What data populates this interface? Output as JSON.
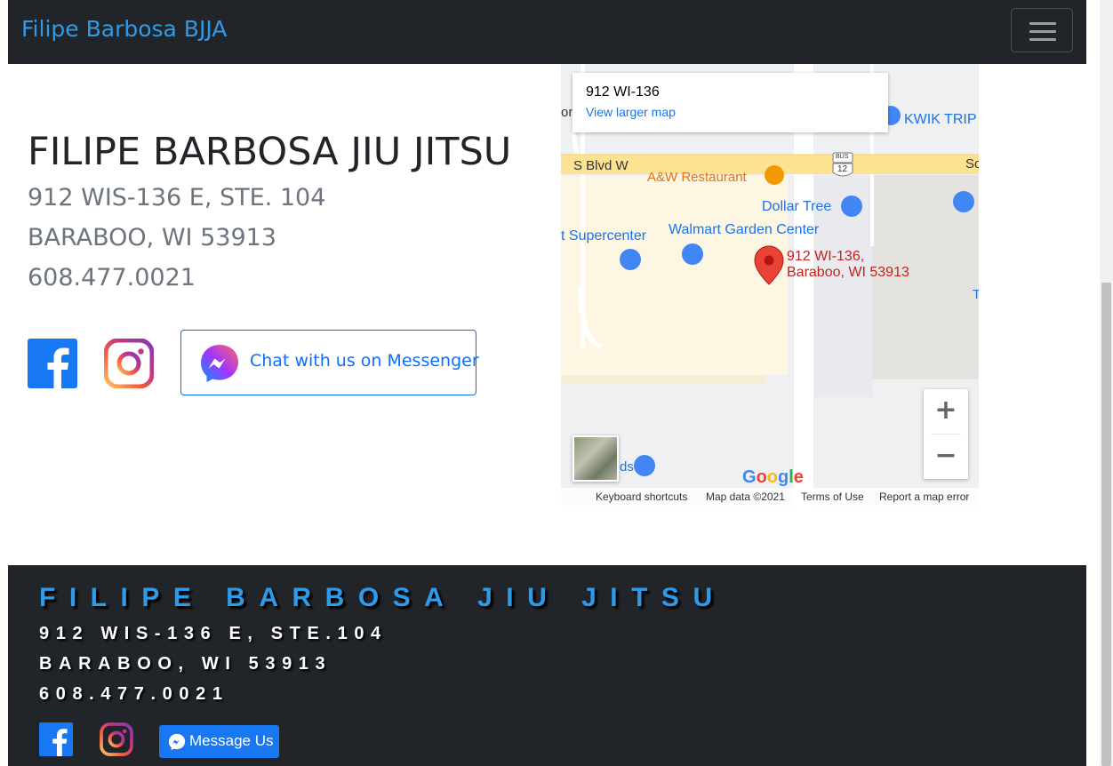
{
  "navbar": {
    "brand": "Filipe Barbosa BJJA",
    "toggle_icon": "hamburger-menu-icon"
  },
  "contact": {
    "title": "FILIPE BARBOSA JIU JITSU",
    "address_line1": "912 WIS-136 E, STE. 104",
    "address_line2": "BARABOO, WI 53913",
    "phone": "608.477.0021",
    "messenger_button": "Chat with us on Messenger",
    "icons": [
      "facebook-icon",
      "instagram-icon",
      "messenger-icon"
    ]
  },
  "map": {
    "card_address": "912 WI-136",
    "card_link": "View larger map",
    "pin_line1": "912 WI-136,",
    "pin_line2": "Baraboo, WI 53913",
    "labels": {
      "s_blvd": "S Blvd W",
      "aw": "A&W Restaurant",
      "kwik": "KWIK TRIP",
      "dollar": "Dollar Tree",
      "supercenter": "t Supercenter",
      "garden": "Walmart Garden Center",
      "so": "So",
      "on": "on",
      "ds": "ds",
      "t": "T",
      "bus": "BUS",
      "route": "12"
    },
    "zoom_in": "+",
    "zoom_out": "−",
    "google_logo": "Google",
    "attribution": {
      "shortcuts": "Keyboard shortcuts",
      "data": "Map data ©2021",
      "terms": "Terms of Use",
      "report": "Report a map error"
    },
    "colors": {
      "road_yellow": "#fde293",
      "area_beige": "#fdf6e3",
      "water_blue": "#4285f4",
      "pin_red": "#ea4335",
      "label_orange": "#e8710a",
      "label_blue": "#1a73e8",
      "pin_text_red": "#c5221f"
    }
  },
  "footer": {
    "title": "FILIPE BARBOSA JIU JITSU",
    "address_line1": "912 WIS-136 E, STE.104",
    "address_line2": "BARABOO, WI 53913",
    "phone": "608.477.0021",
    "message_button": "Message Us"
  },
  "colors": {
    "navbar_bg": "#212529",
    "brand": "#2f9be8",
    "primary": "#0d6efd",
    "muted": "#6c757d",
    "facebook": "#1877f2"
  }
}
